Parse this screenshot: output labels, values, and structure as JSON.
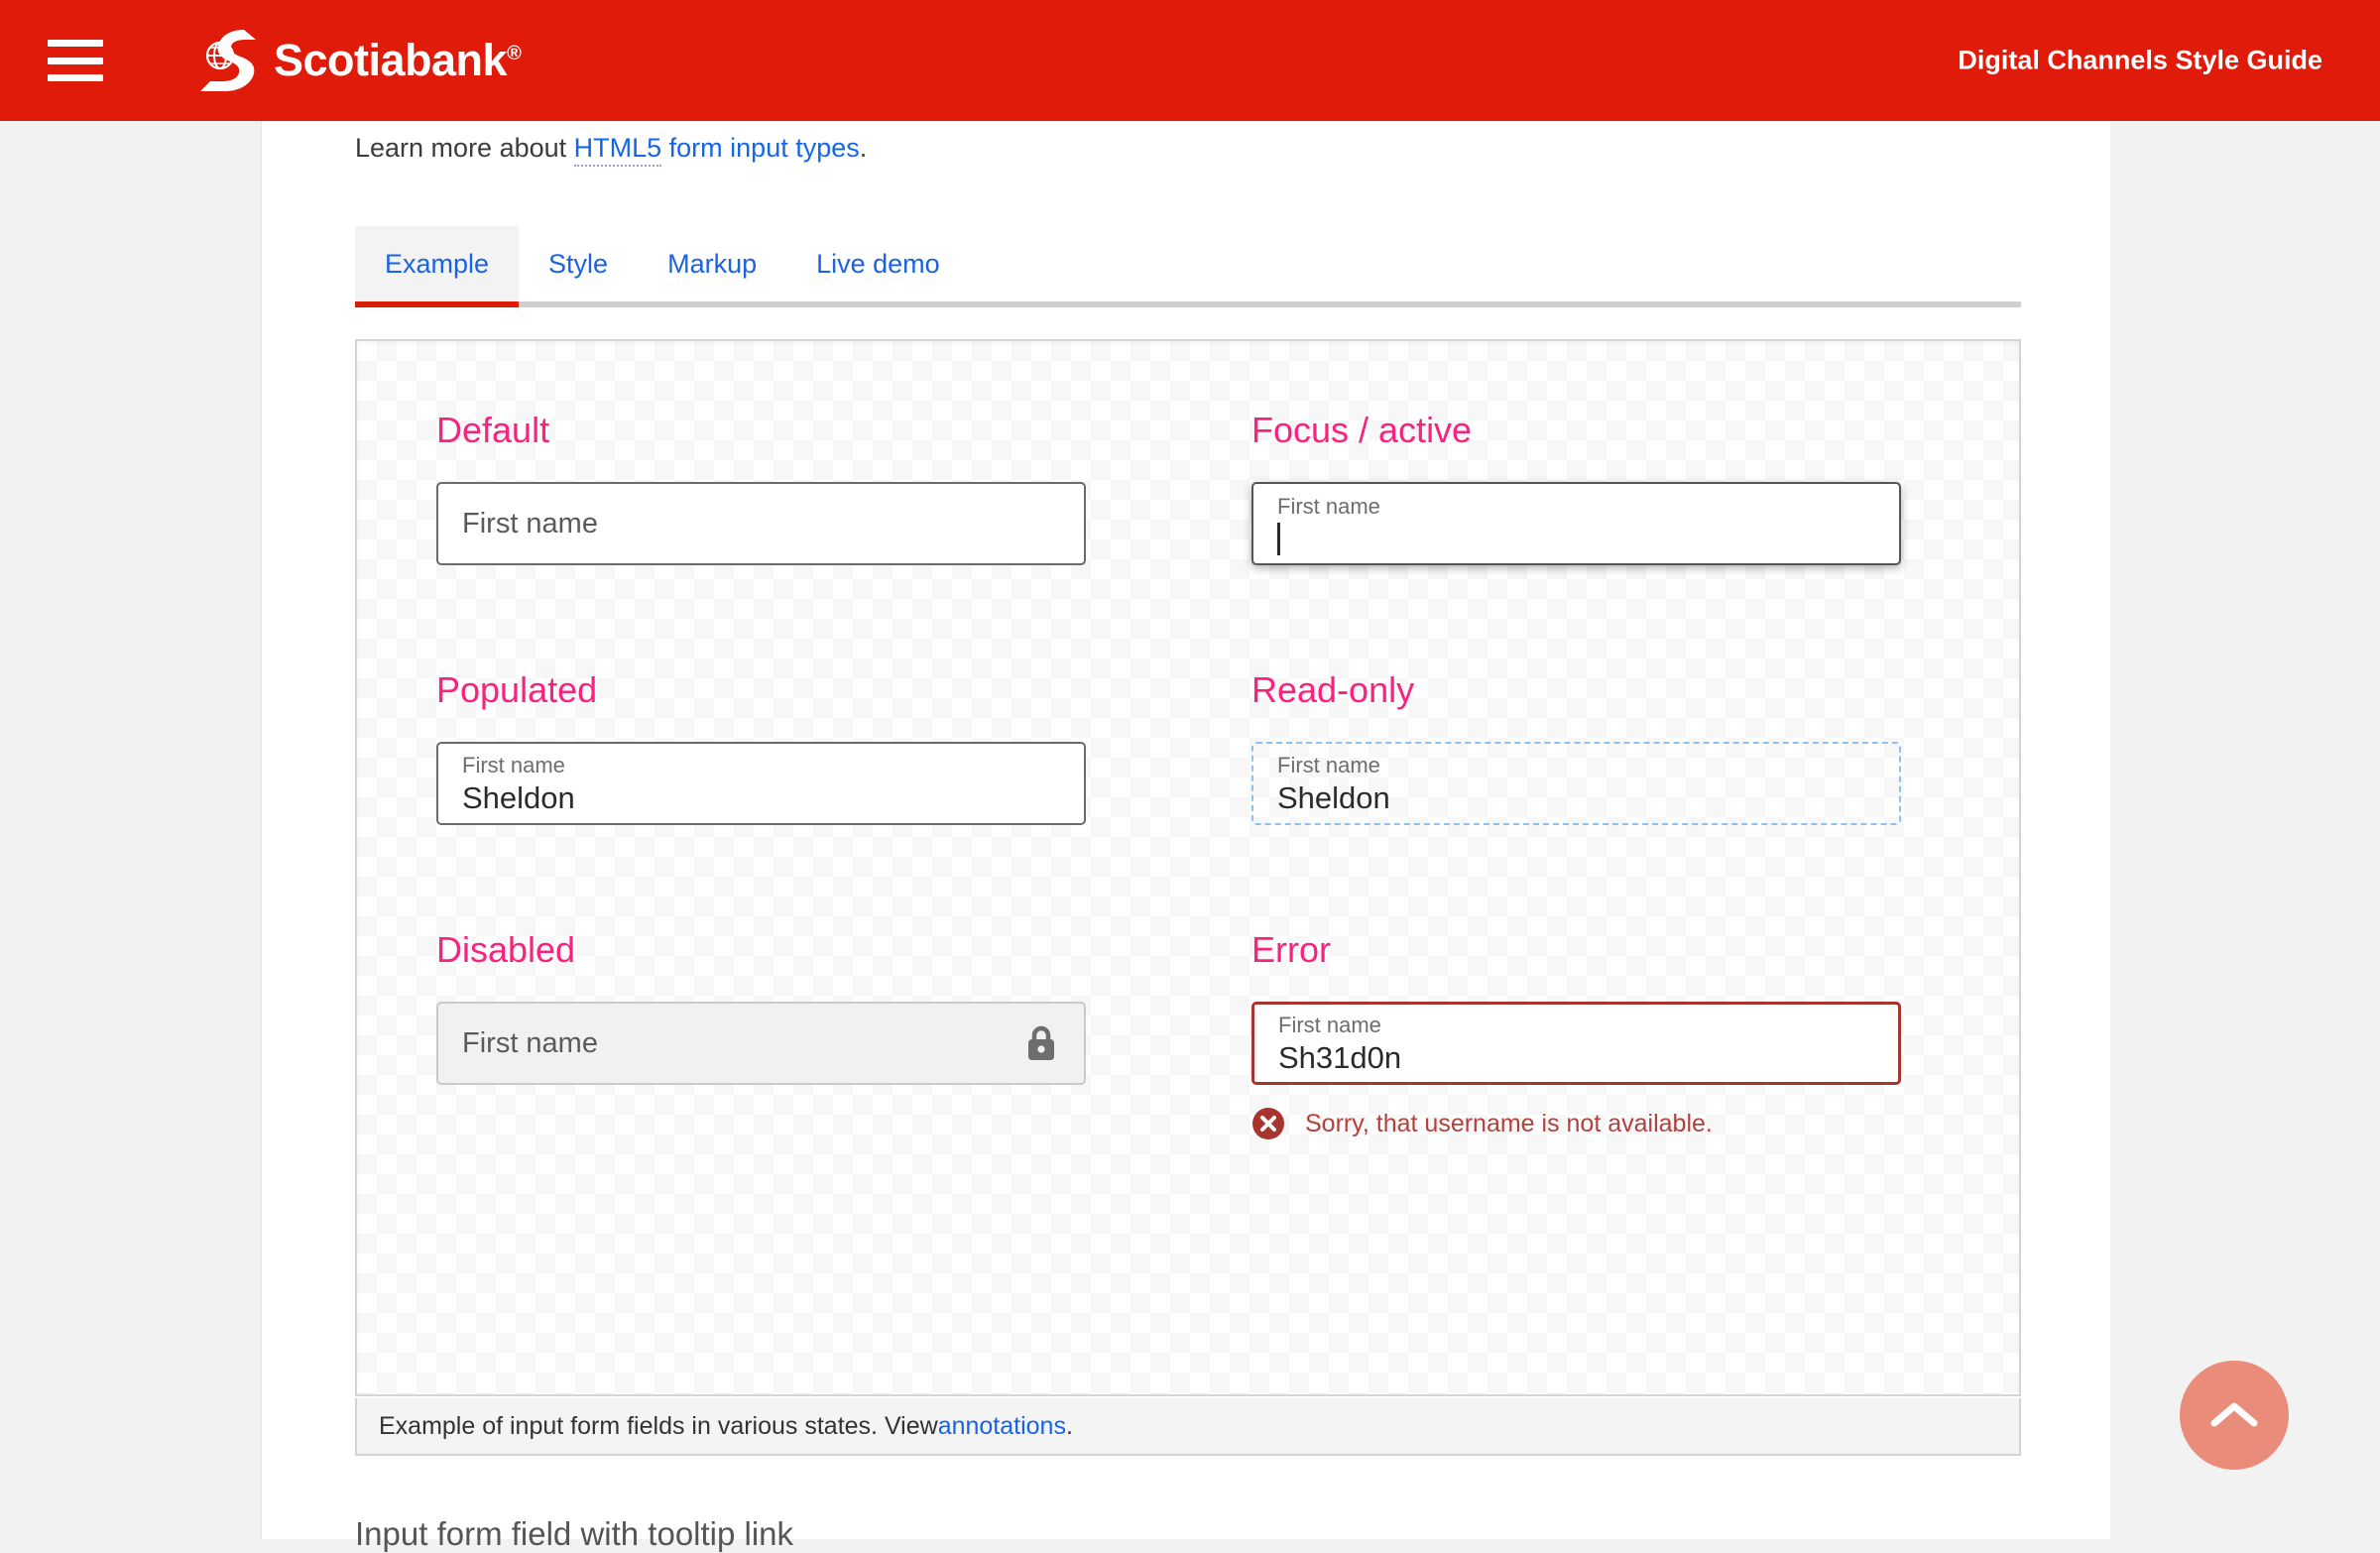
{
  "header": {
    "menu_icon": "hamburger-menu-icon",
    "brand_name": "Scotiabank",
    "brand_registered": "®",
    "brand_icon": "scotiabank-globe-logo",
    "title": "Digital Channels Style Guide",
    "bg_color": "#e01b09"
  },
  "intro": {
    "text_before": "Learn more about ",
    "link_part1": "HTML5",
    "link_part2": " form input types",
    "text_after": ".",
    "link_color": "#1367e8"
  },
  "tabs": [
    {
      "label": "Example",
      "active": true
    },
    {
      "label": "Style",
      "active": false
    },
    {
      "label": "Markup",
      "active": false
    },
    {
      "label": "Live demo",
      "active": false
    }
  ],
  "tab_accent_color": "#d81e05",
  "states": {
    "default": {
      "title": "Default",
      "placeholder": "First name"
    },
    "focus": {
      "title": "Focus / active",
      "label": "First name",
      "value": ""
    },
    "populated": {
      "title": "Populated",
      "label": "First name",
      "value": "Sheldon"
    },
    "readonly": {
      "title": "Read-only",
      "label": "First name",
      "value": "Sheldon"
    },
    "disabled": {
      "title": "Disabled",
      "placeholder": "First name",
      "icon": "lock-icon"
    },
    "error": {
      "title": "Error",
      "label": "First name",
      "value": "Sh31d0n",
      "message": "Sorry, that username is not available.",
      "message_icon": "error-circle-x-icon",
      "border_color": "#a8342e",
      "message_color": "#b2413c"
    }
  },
  "state_title_color": "#f7237f",
  "caption": {
    "text_before": "Example of input form fields in various states. View ",
    "link": "annotations",
    "text_after": "."
  },
  "next_section": {
    "heading": "Input form field with tooltip link"
  },
  "scroll_top": {
    "icon": "chevron-up-icon",
    "color": "#e98c79"
  }
}
